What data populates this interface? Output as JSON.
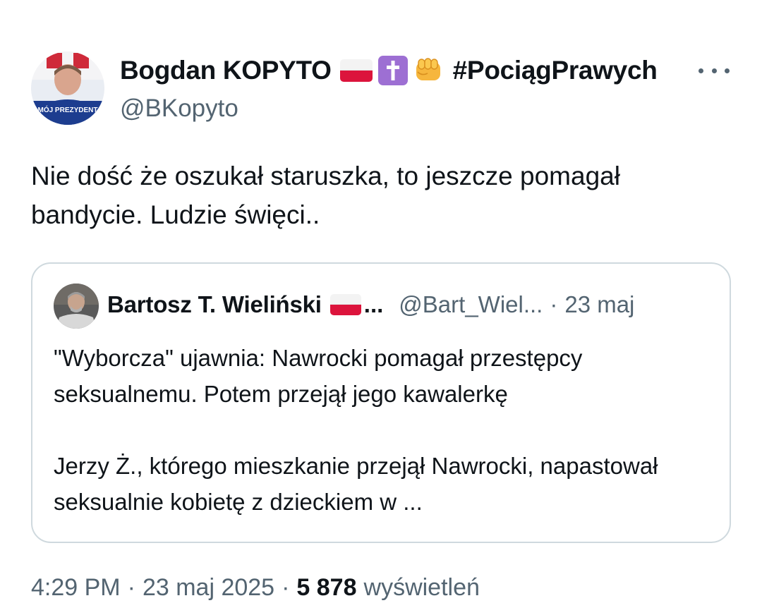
{
  "author": {
    "display_name": "Bogdan KOPYTO",
    "hashtag": "#PociągPrawych",
    "handle": "@BKopyto",
    "avatar_caption": "MÓJ PREZYDENT",
    "emojis": [
      "flag-poland-icon",
      "latin-cross-icon",
      "oncoming-fist-icon"
    ]
  },
  "tweet": {
    "text": "Nie dość że oszukał staruszka, to jeszcze pomagał bandycie. Ludzie święci.."
  },
  "quoted_tweet": {
    "display_name": "Bartosz T. Wieliński",
    "name_ellipsis": "...",
    "handle": "@Bart_Wiel...",
    "separator": "·",
    "date": "23 maj",
    "text": "\"Wyborcza\" ujawnia: Nawrocki pomagał przestępcy seksualnemu. Potem przejął jego kawalerkę\n\nJerzy Ż., którego mieszkanie przejął Nawrocki, napastował  seksualnie kobietę z dzieckiem w ..."
  },
  "meta": {
    "time": "4:29 PM",
    "separator": "·",
    "date": "23 maj 2025",
    "views_count": "5 878",
    "views_label": "wyświetleń"
  },
  "colors": {
    "text_primary": "#0f1419",
    "text_secondary": "#536471",
    "border": "#cfd9de",
    "flag_red": "#dc143c",
    "cross_purple": "#9d6fd3"
  }
}
